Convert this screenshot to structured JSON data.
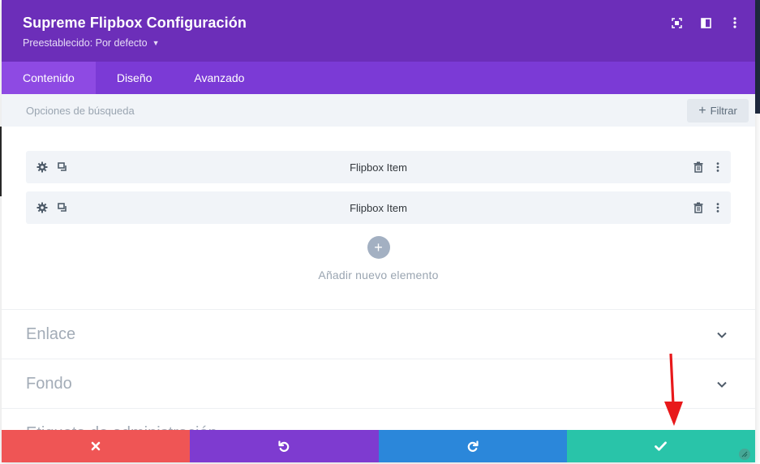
{
  "header": {
    "title": "Supreme Flipbox Configuración",
    "preset_label": "Preestablecido: Por defecto",
    "icons": [
      "fullscreen-icon",
      "sidebar-icon",
      "more-icon"
    ]
  },
  "tabs": [
    {
      "label": "Contenido",
      "active": true
    },
    {
      "label": "Diseño",
      "active": false
    },
    {
      "label": "Avanzado",
      "active": false
    }
  ],
  "search": {
    "placeholder": "Opciones de búsqueda",
    "filter_label": "Filtrar"
  },
  "items": [
    {
      "label": "Flipbox Item"
    },
    {
      "label": "Flipbox Item"
    }
  ],
  "add_item": {
    "label": "Añadir nuevo elemento"
  },
  "sections": [
    {
      "title": "Enlace"
    },
    {
      "title": "Fondo"
    },
    {
      "title": "Etiqueta de administración"
    }
  ],
  "footer": {
    "buttons": [
      "cancel-icon",
      "undo-icon",
      "redo-icon",
      "check-icon"
    ]
  },
  "colors": {
    "header_bg": "#6c2eb9",
    "tabs_bg": "#7b3ad6",
    "cancel": "#ef5555",
    "undo": "#7e3bd0",
    "redo": "#2b87da",
    "save": "#29c4a9",
    "annotation_arrow": "#e8191b"
  }
}
